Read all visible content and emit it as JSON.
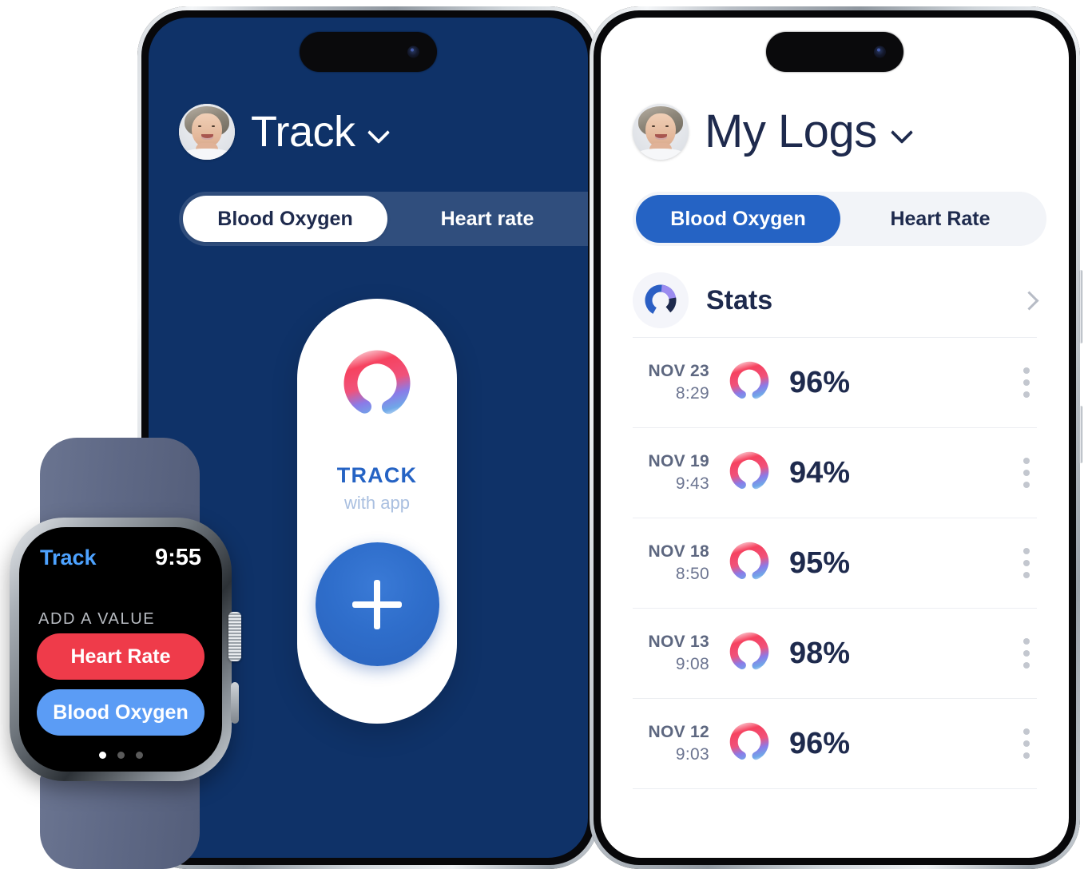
{
  "left_phone": {
    "header": {
      "avatar_alt": "user-avatar",
      "title": "Track",
      "chevron": "chevron-down-icon"
    },
    "tabs": [
      {
        "label": "Blood Oxygen",
        "active": true
      },
      {
        "label": "Heart rate",
        "active": false
      }
    ],
    "track_card": {
      "ring_icon": "gradient-ring-icon",
      "title": "TRACK",
      "subtitle": "with app",
      "add_button_icon": "plus-icon"
    },
    "background_color": "#0F3268"
  },
  "right_phone": {
    "header": {
      "avatar_alt": "user-avatar",
      "title": "My Logs",
      "chevron": "chevron-down-icon"
    },
    "tabs": [
      {
        "label": "Blood Oxygen",
        "active": true
      },
      {
        "label": "Heart Rate",
        "active": false
      }
    ],
    "stats_row": {
      "icon": "donut-chart-icon",
      "label": "Stats",
      "chevron": "chevron-right-icon"
    },
    "logs": [
      {
        "date": "NOV 23",
        "time": "8:29",
        "value": "96%",
        "ring_icon": "gradient-ring-icon",
        "menu_icon": "kebab-menu-icon"
      },
      {
        "date": "NOV 19",
        "time": "9:43",
        "value": "94%",
        "ring_icon": "gradient-ring-icon",
        "menu_icon": "kebab-menu-icon"
      },
      {
        "date": "NOV 18",
        "time": "8:50",
        "value": "95%",
        "ring_icon": "gradient-ring-icon",
        "menu_icon": "kebab-menu-icon"
      },
      {
        "date": "NOV 13",
        "time": "9:08",
        "value": "98%",
        "ring_icon": "gradient-ring-icon",
        "menu_icon": "kebab-menu-icon"
      },
      {
        "date": "NOV 12",
        "time": "9:03",
        "value": "96%",
        "ring_icon": "gradient-ring-icon",
        "menu_icon": "kebab-menu-icon"
      }
    ],
    "background_color": "#FFFFFF"
  },
  "watch": {
    "app_name": "Track",
    "time": "9:55",
    "section_label": "ADD A VALUE",
    "buttons": [
      {
        "label": "Heart Rate",
        "color": "#EF3B4A"
      },
      {
        "label": "Blood Oxygen",
        "color": "#5B9CF5"
      }
    ],
    "page_dots": {
      "count": 3,
      "active_index": 0
    }
  },
  "colors": {
    "navy": "#0F3268",
    "accent_blue": "#2563C4",
    "text_dark": "#1E2A4D",
    "ring_pink": "#F6425F",
    "ring_blue": "#6FA8E8",
    "ring_purple": "#8A7BE8",
    "watch_red": "#EF3B4A",
    "watch_blue": "#5B9CF5",
    "muted": "#5D6780"
  }
}
